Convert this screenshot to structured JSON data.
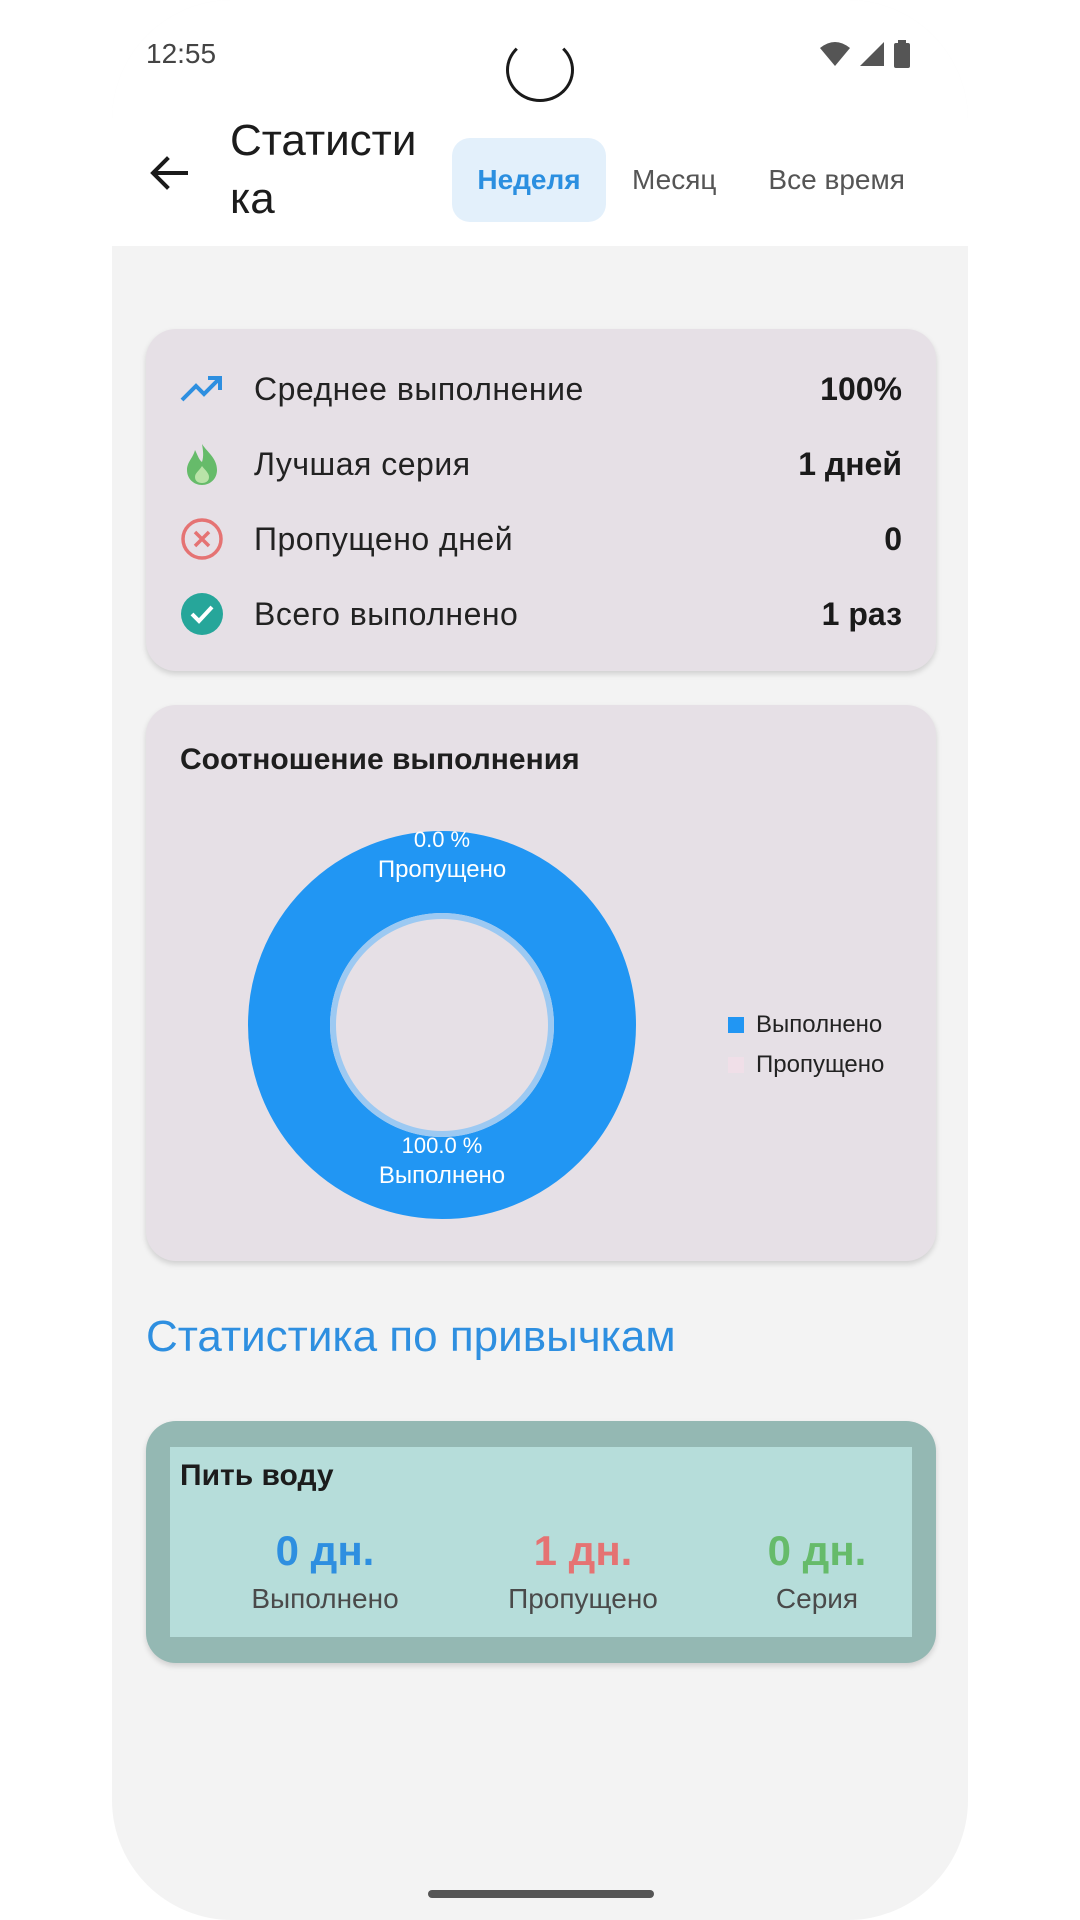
{
  "status_bar": {
    "time": "12:55"
  },
  "app_bar": {
    "back_icon": "arrow-left-icon",
    "title": "Статистика",
    "tabs": [
      {
        "label": "Неделя",
        "active": true
      },
      {
        "label": "Месяц",
        "active": false
      },
      {
        "label": "Все время",
        "active": false
      }
    ]
  },
  "summary": {
    "rows": [
      {
        "icon": "trending-up-icon",
        "label": "Среднее выполнение",
        "value": "100%"
      },
      {
        "icon": "flame-icon",
        "label": "Лучшая серия",
        "value": "1 дней"
      },
      {
        "icon": "cancel-circle-icon",
        "label": "Пропущено дней",
        "value": "0"
      },
      {
        "icon": "check-circle-icon",
        "label": "Всего выполнено",
        "value": "1 раз"
      }
    ]
  },
  "chart_data": {
    "type": "pie",
    "title": "Соотношение выполнения",
    "categories": [
      "Выполнено",
      "Пропущено"
    ],
    "values": [
      100.0,
      0.0
    ],
    "slice_labels": [
      {
        "percent": "100.0 %",
        "name": "Выполнено"
      },
      {
        "percent": "0.0 %",
        "name": "Пропущено"
      }
    ],
    "legend": "right",
    "colors": [
      "#2196f3",
      "#f0dfe8"
    ]
  },
  "habits_section": {
    "title": "Статистика по привычкам",
    "habits": [
      {
        "name": "Пить воду",
        "stats": [
          {
            "value": "0 дн.",
            "label": "Выполнено",
            "color": "#2e8fe0"
          },
          {
            "value": "1 дн.",
            "label": "Пропущено",
            "color": "#e57373"
          },
          {
            "value": "0 дн.",
            "label": "Серия",
            "color": "#66bb6a"
          }
        ]
      }
    ]
  },
  "colors": {
    "accent": "#2b8fe0",
    "card_bg": "#e6e0e6",
    "habit_card_border": "#94b8b3",
    "habit_card_bg": "#b6ddda"
  }
}
